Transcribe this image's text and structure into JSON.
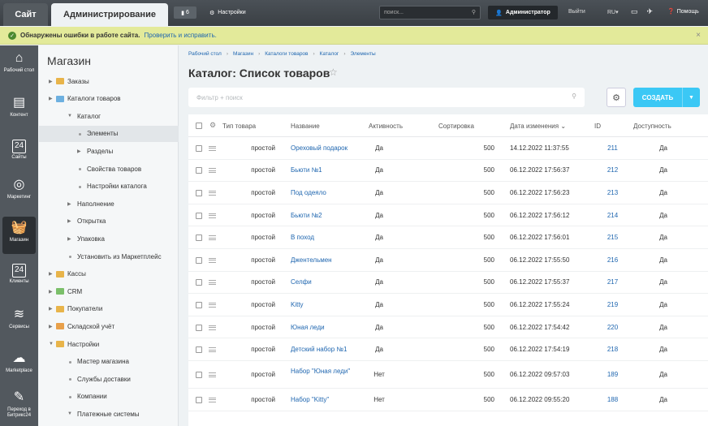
{
  "topbar": {
    "tab_site": "Сайт",
    "tab_admin": "Администрирование",
    "notif_count": "6",
    "settings": "Настройки",
    "search_placeholder": "поиск...",
    "user": "Администратор",
    "logout": "Выйти",
    "lang": "RU",
    "help": "Помощь"
  },
  "error_bar": {
    "message": "Обнаружены ошибки в работе сайта.",
    "link": "Проверить и исправить."
  },
  "left_nav": [
    {
      "label": "Рабочий стол",
      "icon": "home-icon",
      "glyph": "⌂"
    },
    {
      "label": "Контент",
      "icon": "document-icon",
      "glyph": "▤"
    },
    {
      "label": "Сайты",
      "icon": "calendar-icon",
      "glyph": "24"
    },
    {
      "label": "Маркетинг",
      "icon": "target-icon",
      "glyph": "◎"
    },
    {
      "label": "Магазин",
      "icon": "basket-icon",
      "glyph": "🧺"
    },
    {
      "label": "Клиенты",
      "icon": "clients-icon",
      "glyph": "24"
    },
    {
      "label": "Сервисы",
      "icon": "layers-icon",
      "glyph": "≋"
    },
    {
      "label": "Marketplace",
      "icon": "cloud-icon",
      "glyph": "☁"
    },
    {
      "label": "Переход в Битрикс24",
      "icon": "bitrix24-icon",
      "glyph": "✎"
    }
  ],
  "menu": {
    "title": "Магазин",
    "items": [
      {
        "label": "Заказы",
        "level": 0,
        "type": "folder",
        "arrow": "▶"
      },
      {
        "label": "Каталоги товаров",
        "level": 0,
        "type": "folder",
        "arrow": "▶"
      },
      {
        "label": "Каталог",
        "level": 1,
        "type": "arrow",
        "arrow": "▼"
      },
      {
        "label": "Элементы",
        "level": 2,
        "type": "dot",
        "active": true
      },
      {
        "label": "Разделы",
        "level": 2,
        "type": "arrow",
        "arrow": "▶"
      },
      {
        "label": "Свойства товаров",
        "level": 2,
        "type": "dot"
      },
      {
        "label": "Настройки каталога",
        "level": 2,
        "type": "dot"
      },
      {
        "label": "Наполнение",
        "level": 1,
        "type": "arrow",
        "arrow": "▶"
      },
      {
        "label": "Открытка",
        "level": 1,
        "type": "arrow",
        "arrow": "▶"
      },
      {
        "label": "Упаковка",
        "level": 1,
        "type": "arrow",
        "arrow": "▶"
      },
      {
        "label": "Установить из Маркетплейс",
        "level": 1,
        "type": "dot"
      },
      {
        "label": "Кассы",
        "level": 0,
        "type": "folder",
        "arrow": "▶"
      },
      {
        "label": "CRM",
        "level": 0,
        "type": "folder",
        "arrow": "▶"
      },
      {
        "label": "Покупатели",
        "level": 0,
        "type": "folder",
        "arrow": "▶"
      },
      {
        "label": "Складской учёт",
        "level": 0,
        "type": "folder",
        "arrow": "▶"
      },
      {
        "label": "Настройки",
        "level": 0,
        "type": "folder",
        "arrow": "▼"
      },
      {
        "label": "Мастер магазина",
        "level": 1,
        "type": "dot"
      },
      {
        "label": "Службы доставки",
        "level": 1,
        "type": "dot"
      },
      {
        "label": "Компании",
        "level": 1,
        "type": "dot"
      },
      {
        "label": "Платежные системы",
        "level": 1,
        "type": "arrow",
        "arrow": "▼"
      }
    ]
  },
  "breadcrumbs": [
    "Рабочий стол",
    "Магазин",
    "Каталоги товаров",
    "Каталог",
    "Элементы"
  ],
  "page_title": "Каталог: Список товаров",
  "filter_placeholder": "Фильтр + поиск",
  "create_label": "СОЗДАТЬ",
  "grid": {
    "columns": {
      "type": "Тип товара",
      "name": "Название",
      "active": "Активность",
      "sort": "Сортировка",
      "date": "Дата изменения",
      "id": "ID",
      "avail": "Доступность"
    },
    "rows": [
      {
        "type": "простой",
        "name": "Ореховый подарок",
        "active": "Да",
        "sort": "500",
        "date": "14.12.2022 11:37:55",
        "id": "211",
        "avail": "Да"
      },
      {
        "type": "простой",
        "name": "Бьюти №1",
        "active": "Да",
        "sort": "500",
        "date": "06.12.2022 17:56:37",
        "id": "212",
        "avail": "Да"
      },
      {
        "type": "простой",
        "name": "Под одеяло",
        "active": "Да",
        "sort": "500",
        "date": "06.12.2022 17:56:23",
        "id": "213",
        "avail": "Да"
      },
      {
        "type": "простой",
        "name": "Бьюти №2",
        "active": "Да",
        "sort": "500",
        "date": "06.12.2022 17:56:12",
        "id": "214",
        "avail": "Да"
      },
      {
        "type": "простой",
        "name": "В поход",
        "active": "Да",
        "sort": "500",
        "date": "06.12.2022 17:56:01",
        "id": "215",
        "avail": "Да"
      },
      {
        "type": "простой",
        "name": "Джентельмен",
        "active": "Да",
        "sort": "500",
        "date": "06.12.2022 17:55:50",
        "id": "216",
        "avail": "Да"
      },
      {
        "type": "простой",
        "name": "Селфи",
        "active": "Да",
        "sort": "500",
        "date": "06.12.2022 17:55:37",
        "id": "217",
        "avail": "Да"
      },
      {
        "type": "простой",
        "name": "Kitty",
        "active": "Да",
        "sort": "500",
        "date": "06.12.2022 17:55:24",
        "id": "219",
        "avail": "Да"
      },
      {
        "type": "простой",
        "name": "Юная леди",
        "active": "Да",
        "sort": "500",
        "date": "06.12.2022 17:54:42",
        "id": "220",
        "avail": "Да"
      },
      {
        "type": "простой",
        "name": "Детский набор №1",
        "active": "Да",
        "sort": "500",
        "date": "06.12.2022 17:54:19",
        "id": "218",
        "avail": "Да"
      },
      {
        "type": "простой",
        "name": "Набор \"Юная леди\"",
        "active": "Нет",
        "sort": "500",
        "date": "06.12.2022 09:57:03",
        "id": "189",
        "avail": "Да"
      },
      {
        "type": "простой",
        "name": "Набор \"Kitty\"",
        "active": "Нет",
        "sort": "500",
        "date": "06.12.2022 09:55:20",
        "id": "188",
        "avail": "Да"
      }
    ]
  }
}
